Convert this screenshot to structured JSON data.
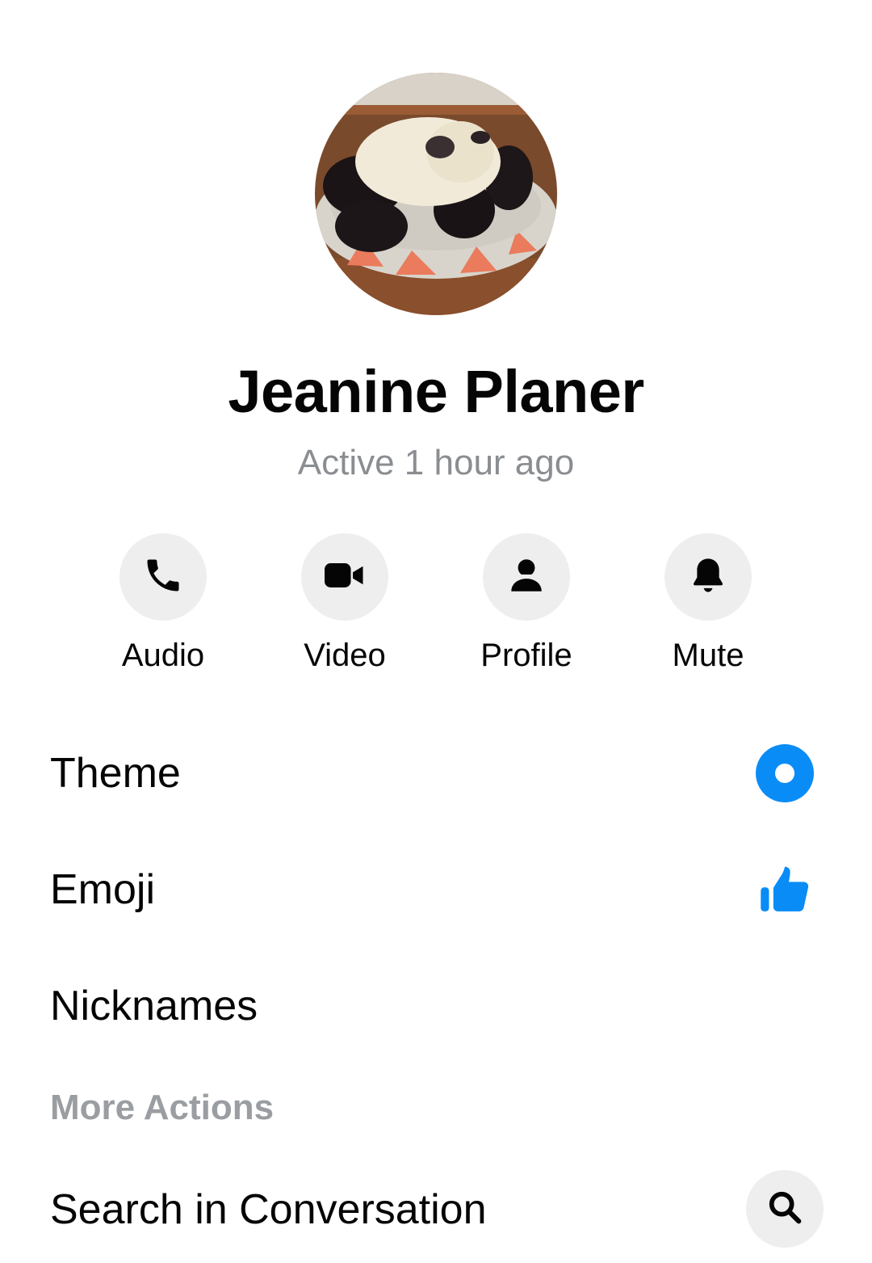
{
  "contact": {
    "name": "Jeanine Planer",
    "status": "Active 1 hour ago",
    "avatar_icon": "pug-puppies-photo"
  },
  "quick_actions": [
    {
      "label": "Audio",
      "icon": "phone-icon"
    },
    {
      "label": "Video",
      "icon": "video-camera-icon"
    },
    {
      "label": "Profile",
      "icon": "person-icon"
    },
    {
      "label": "Mute",
      "icon": "bell-icon"
    }
  ],
  "settings": {
    "theme_label": "Theme",
    "emoji_label": "Emoji",
    "nicknames_label": "Nicknames"
  },
  "more_actions": {
    "header": "More Actions",
    "search_label": "Search in Conversation"
  },
  "colors": {
    "accent": "#0a8cf7",
    "icon_bg": "#eeeeef",
    "muted_text": "#8a8d91"
  }
}
